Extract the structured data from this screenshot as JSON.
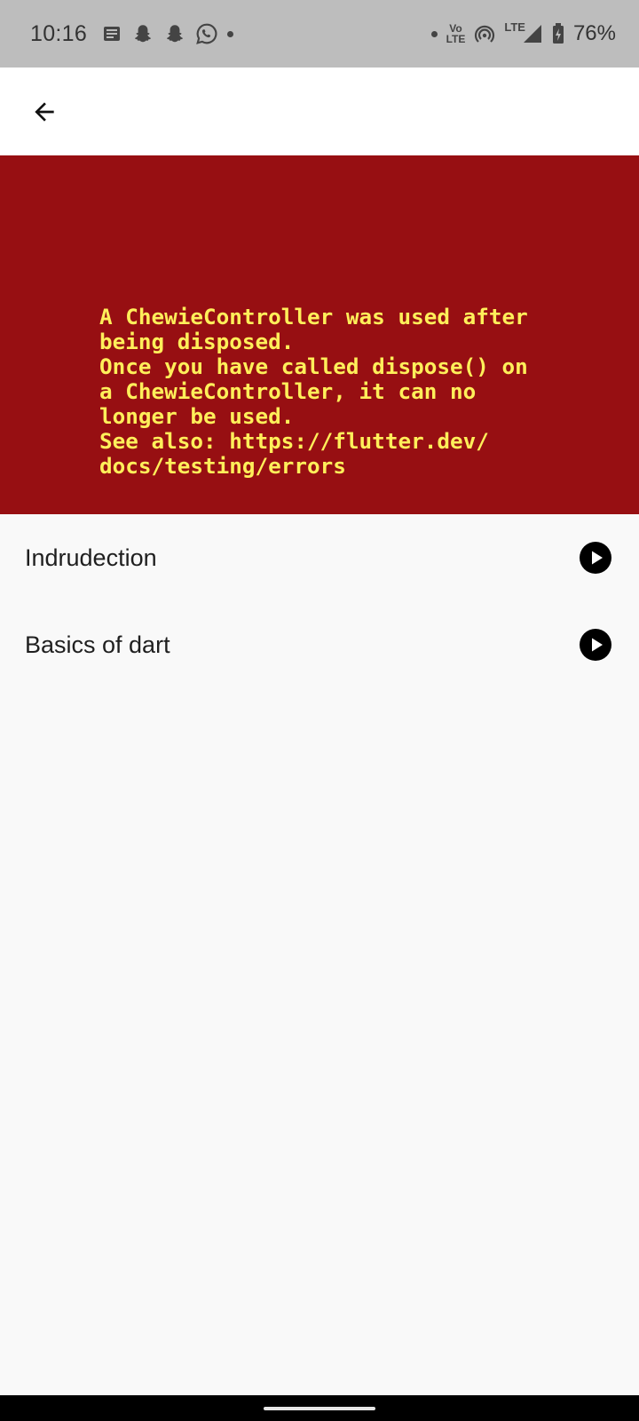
{
  "status_bar": {
    "time": "10:16",
    "battery_percent": "76%",
    "volte_top": "Vo",
    "volte_bottom": "LTE",
    "lte_label": "LTE",
    "left_icons": [
      "news-icon",
      "snapchat-icon",
      "snapchat-icon",
      "whatsapp-icon",
      "dot-icon"
    ],
    "right_icons": [
      "dot-icon",
      "volte-icon",
      "hotspot-icon",
      "lte-signal-icon",
      "battery-icon"
    ]
  },
  "app_bar": {
    "back_icon": "arrow-back-icon"
  },
  "error": {
    "message": "A ChewieController was used after\nbeing disposed.\nOnce you have called dispose() on\na ChewieController, it can no\nlonger be used.\nSee also: https://flutter.dev/\ndocs/testing/errors",
    "background_color": "#970f12",
    "text_color": "#ffef5a"
  },
  "lessons": [
    {
      "title": "Indrudection",
      "icon": "play-circle-icon"
    },
    {
      "title": "Basics of dart",
      "icon": "play-circle-icon"
    }
  ]
}
